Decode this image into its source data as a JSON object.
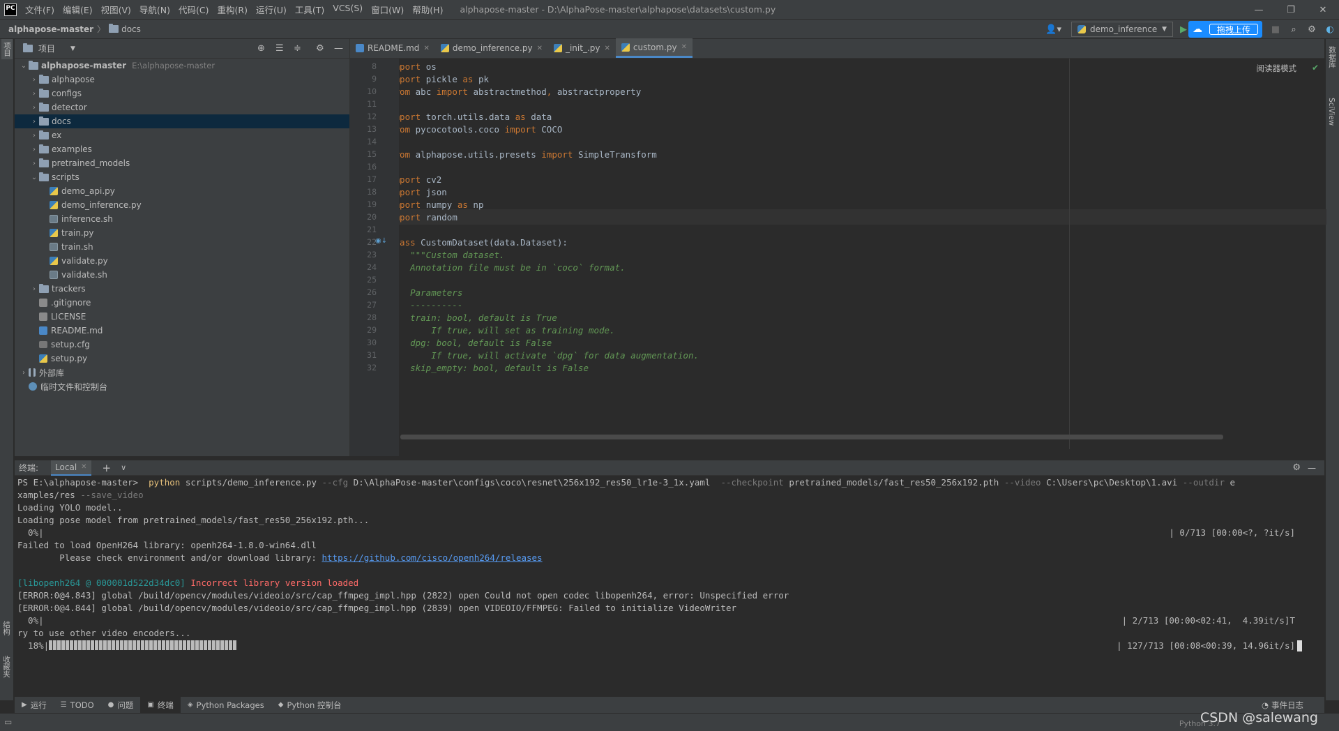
{
  "app": {
    "logo": "PC",
    "window_title": "alphapose-master - D:\\AlphaPose-master\\alphapose\\datasets\\custom.py"
  },
  "menu": [
    "文件(F)",
    "编辑(E)",
    "视图(V)",
    "导航(N)",
    "代码(C)",
    "重构(R)",
    "运行(U)",
    "工具(T)",
    "VCS(S)",
    "窗口(W)",
    "帮助(H)"
  ],
  "breadcrumb": {
    "root": "alphapose-master",
    "folder": "docs"
  },
  "run_config": {
    "label": "demo_inference"
  },
  "upload": {
    "label": "拖拽上传"
  },
  "side_tabs": {
    "project": "项目",
    "structure": "结构",
    "favorites": "收藏夹",
    "database": "数据库",
    "sciview": "SciView"
  },
  "project_panel": {
    "title": "项目",
    "tree": [
      {
        "name": "alphapose-master",
        "path": "E:\\alphapose-master",
        "type": "folder",
        "depth": 0,
        "expanded": true,
        "bold": true
      },
      {
        "name": "alphapose",
        "type": "folder",
        "depth": 1,
        "expanded": false
      },
      {
        "name": "configs",
        "type": "folder",
        "depth": 1,
        "expanded": false
      },
      {
        "name": "detector",
        "type": "folder",
        "depth": 1,
        "expanded": false
      },
      {
        "name": "docs",
        "type": "folder",
        "depth": 1,
        "expanded": false,
        "selected": true
      },
      {
        "name": "ex",
        "type": "folder",
        "depth": 1,
        "expanded": false
      },
      {
        "name": "examples",
        "type": "folder",
        "depth": 1,
        "expanded": false
      },
      {
        "name": "pretrained_models",
        "type": "folder",
        "depth": 1,
        "expanded": false
      },
      {
        "name": "scripts",
        "type": "folder",
        "depth": 1,
        "expanded": true
      },
      {
        "name": "demo_api.py",
        "type": "py",
        "depth": 2
      },
      {
        "name": "demo_inference.py",
        "type": "py",
        "depth": 2
      },
      {
        "name": "inference.sh",
        "type": "sh",
        "depth": 2
      },
      {
        "name": "train.py",
        "type": "py",
        "depth": 2
      },
      {
        "name": "train.sh",
        "type": "sh",
        "depth": 2
      },
      {
        "name": "validate.py",
        "type": "py",
        "depth": 2
      },
      {
        "name": "validate.sh",
        "type": "sh",
        "depth": 2
      },
      {
        "name": "trackers",
        "type": "folder",
        "depth": 1,
        "expanded": false
      },
      {
        "name": ".gitignore",
        "type": "txt",
        "depth": 1
      },
      {
        "name": "LICENSE",
        "type": "txt",
        "depth": 1
      },
      {
        "name": "README.md",
        "type": "md",
        "depth": 1
      },
      {
        "name": "setup.cfg",
        "type": "cfg",
        "depth": 1
      },
      {
        "name": "setup.py",
        "type": "py",
        "depth": 1
      },
      {
        "name": "外部库",
        "type": "lib",
        "depth": 0,
        "expanded": false
      },
      {
        "name": "临时文件和控制台",
        "type": "scratch",
        "depth": 0
      }
    ]
  },
  "editor": {
    "tabs": [
      {
        "label": "README.md",
        "icon": "md",
        "active": false
      },
      {
        "label": "demo_inference.py",
        "icon": "py",
        "active": false
      },
      {
        "label": "_init_.py",
        "icon": "py",
        "active": false
      },
      {
        "label": "custom.py",
        "icon": "py",
        "active": true
      }
    ],
    "reader_mode": "阅读器模式",
    "current_line": 17,
    "lines": [
      {
        "n": 8,
        "t": [
          [
            "kw",
            "import "
          ],
          [
            "",
            "os"
          ]
        ]
      },
      {
        "n": 9,
        "t": [
          [
            "kw",
            "import "
          ],
          [
            "",
            "pickle "
          ],
          [
            "kw",
            "as "
          ],
          [
            "",
            "pk"
          ]
        ]
      },
      {
        "n": 10,
        "t": [
          [
            "kw",
            "from "
          ],
          [
            "",
            "abc "
          ],
          [
            "kw",
            "import "
          ],
          [
            "",
            "abstractmethod"
          ],
          [
            "kw",
            ", "
          ],
          [
            "",
            "abstractproperty"
          ]
        ]
      },
      {
        "n": 11,
        "t": []
      },
      {
        "n": 12,
        "t": [
          [
            "kw",
            "import "
          ],
          [
            "",
            "torch.utils.data "
          ],
          [
            "kw",
            "as "
          ],
          [
            "",
            "data"
          ]
        ]
      },
      {
        "n": 13,
        "t": [
          [
            "kw",
            "from "
          ],
          [
            "",
            "pycocotools.coco "
          ],
          [
            "kw",
            "import "
          ],
          [
            "",
            "COCO"
          ]
        ]
      },
      {
        "n": 14,
        "t": []
      },
      {
        "n": 15,
        "t": [
          [
            "kw",
            "from "
          ],
          [
            "",
            "alphapose.utils.presets "
          ],
          [
            "kw",
            "import "
          ],
          [
            "",
            "SimpleTransform"
          ]
        ]
      },
      {
        "n": 16,
        "t": []
      },
      {
        "n": 17,
        "t": [
          [
            "kw",
            "import "
          ],
          [
            "",
            "cv2"
          ]
        ]
      },
      {
        "n": 18,
        "t": [
          [
            "kw",
            "import "
          ],
          [
            "",
            "json"
          ]
        ]
      },
      {
        "n": 19,
        "t": [
          [
            "kw",
            "import "
          ],
          [
            "",
            "numpy "
          ],
          [
            "kw",
            "as "
          ],
          [
            "",
            "np"
          ]
        ]
      },
      {
        "n": 20,
        "t": [
          [
            "kw",
            "import "
          ],
          [
            "",
            "random"
          ]
        ]
      },
      {
        "n": 21,
        "t": []
      },
      {
        "n": 22,
        "t": [
          [
            "kw",
            "class "
          ],
          [
            "",
            "CustomDataset(data.Dataset):"
          ]
        ]
      },
      {
        "n": 23,
        "t": [
          [
            "doc",
            "    \"\"\"Custom dataset."
          ]
        ]
      },
      {
        "n": 24,
        "t": [
          [
            "doc",
            "    Annotation file must be in `coco` format."
          ]
        ]
      },
      {
        "n": 25,
        "t": []
      },
      {
        "n": 26,
        "t": [
          [
            "doc",
            "    Parameters"
          ]
        ]
      },
      {
        "n": 27,
        "t": [
          [
            "doc",
            "    ----------"
          ]
        ]
      },
      {
        "n": 28,
        "t": [
          [
            "doc",
            "    train: bool, default is True"
          ]
        ]
      },
      {
        "n": 29,
        "t": [
          [
            "doc",
            "        If true, will set as training mode."
          ]
        ]
      },
      {
        "n": 30,
        "t": [
          [
            "doc",
            "    dpg: bool, default is False"
          ]
        ]
      },
      {
        "n": 31,
        "t": [
          [
            "doc",
            "        If true, will activate `dpg` for data augmentation."
          ]
        ]
      },
      {
        "n": 32,
        "t": [
          [
            "doc",
            "    skip_empty: bool, default is False"
          ]
        ]
      }
    ]
  },
  "terminal": {
    "title": "终端:",
    "tab": "Local",
    "lines": [
      [
        [
          "",
          "PS E:\\alphapose-master>  "
        ],
        [
          "cmd",
          "python"
        ],
        [
          "",
          " scripts/demo_inference.py "
        ],
        [
          "dim",
          "--cfg "
        ],
        [
          "",
          "D:\\AlphaPose-master\\configs\\coco\\resnet\\256x192_res50_lr1e-3_1x.yaml  "
        ],
        [
          "dim",
          "--checkpoint "
        ],
        [
          "",
          "pretrained_models/fast_res50_256x192.pth "
        ],
        [
          "dim",
          "--video "
        ],
        [
          "",
          "C:\\Users\\pc\\Desktop\\1.avi "
        ],
        [
          "dim",
          "--outdir "
        ],
        [
          "",
          "e"
        ]
      ],
      [
        [
          "",
          "xamples/res "
        ],
        [
          "dim",
          "--save_video"
        ]
      ],
      [
        [
          "",
          "Loading YOLO model.."
        ]
      ],
      [
        [
          "",
          "Loading pose model from pretrained_models/fast_res50_256x192.pth..."
        ]
      ],
      [
        [
          "",
          "  0%|"
        ]
      ],
      [
        [
          "",
          "Failed to load OpenH264 library: openh264-1.8.0-win64.dll"
        ]
      ],
      [
        [
          "",
          "        Please check environment and/or download library: "
        ],
        [
          "link",
          "https://github.com/cisco/openh264/releases"
        ]
      ],
      [],
      [
        [
          "cyan",
          "[libopenh264 @ 000001d522d34dc0] "
        ],
        [
          "red",
          "Incorrect library version loaded"
        ]
      ],
      [
        [
          "",
          "[ERROR:0@4.843] global /build/opencv/modules/videoio/src/cap_ffmpeg_impl.hpp (2822) open Could not open codec libopenh264, error: Unspecified error"
        ]
      ],
      [
        [
          "",
          "[ERROR:0@4.844] global /build/opencv/modules/videoio/src/cap_ffmpeg_impl.hpp (2839) open VIDEOIO/FFMPEG: Failed to initialize VideoWriter"
        ]
      ],
      [
        [
          "",
          "  0%|"
        ]
      ],
      [
        [
          "",
          "ry to use other video encoders..."
        ]
      ],
      [
        [
          "",
          "  18%|"
        ]
      ]
    ],
    "right_texts": [
      {
        "line": 4,
        "text": "| 0/713 [00:00<?, ?it/s]"
      },
      {
        "line": 11,
        "text": "| 2/713 [00:00<02:41,  4.39it/s]T"
      },
      {
        "line": 13,
        "text": "| 127/713 [00:08<00:39, 14.96it/s]"
      }
    ],
    "progress_fraction": 0.18
  },
  "bottom_tabs": [
    {
      "label": "运行",
      "icon": "▶"
    },
    {
      "label": "TODO",
      "icon": "☰"
    },
    {
      "label": "问题",
      "icon": "●"
    },
    {
      "label": "终端",
      "icon": "▣",
      "active": true
    },
    {
      "label": "Python Packages",
      "icon": "◈"
    },
    {
      "label": "Python 控制台",
      "icon": "◆"
    }
  ],
  "event_log": "事件日志",
  "status": {
    "python": "Python 3.7",
    "watermark": "CSDN @salewang"
  }
}
